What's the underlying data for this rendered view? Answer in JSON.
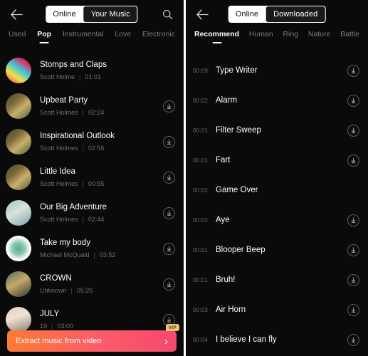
{
  "left_panel": {
    "back_icon": "back-arrow-icon",
    "search_icon": "search-icon",
    "segmented": {
      "online": "Online",
      "selected": "Your Music"
    },
    "categories": [
      "Used",
      "Pop",
      "Instrumental",
      "Love",
      "Electronic"
    ],
    "active_category": "Pop",
    "songs": [
      {
        "title": "Stomps and Claps",
        "artist": "Scott Holme",
        "duration": "01:01",
        "has_download": false,
        "art": "art-rainbow"
      },
      {
        "title": "Upbeat Party",
        "artist": "Scott Holmes",
        "duration": "02:24",
        "has_download": true,
        "art": "art-forest"
      },
      {
        "title": "Inspirational Outlook",
        "artist": "Scott Holmes",
        "duration": "02:56",
        "has_download": true,
        "art": "art-forest"
      },
      {
        "title": "Little Idea",
        "artist": "Scott Holmes",
        "duration": "00:55",
        "has_download": true,
        "art": "art-forest"
      },
      {
        "title": "Our Big Adventure",
        "artist": "Scott Holmes",
        "duration": "02:44",
        "has_download": true,
        "art": "art-map"
      },
      {
        "title": "Take my body",
        "artist": "Michael McQuaid",
        "duration": "03:52",
        "has_download": true,
        "art": "art-plate"
      },
      {
        "title": "CROWN",
        "artist": "Unknown",
        "duration": "05:26",
        "has_download": true,
        "art": "art-room"
      },
      {
        "title": "JULY",
        "artist": "19",
        "duration": "03:00",
        "has_download": true,
        "art": "art-tree"
      }
    ],
    "banner": {
      "text": "Extract music from video",
      "badge": "VIP",
      "chevron": "chevron-right-icon"
    }
  },
  "right_panel": {
    "back_icon": "back-arrow-icon",
    "segmented": {
      "online": "Online",
      "selected": "Downloaded"
    },
    "categories": [
      "Recommend",
      "Human",
      "Ring",
      "Nature",
      "Battle"
    ],
    "active_category": "Recommend",
    "sounds": [
      {
        "duration": "00:09",
        "name": "Type Writer",
        "has_download": true
      },
      {
        "duration": "00:02",
        "name": "Alarm",
        "has_download": true
      },
      {
        "duration": "00:01",
        "name": "Filter Sweep",
        "has_download": true
      },
      {
        "duration": "00:01",
        "name": "Fart",
        "has_download": true
      },
      {
        "duration": "00:02",
        "name": "Game Over",
        "has_download": false
      },
      {
        "duration": "00:02",
        "name": "Aye",
        "has_download": true
      },
      {
        "duration": "00:01",
        "name": "Blooper Beep",
        "has_download": true
      },
      {
        "duration": "00:01",
        "name": "Bruh!",
        "has_download": true
      },
      {
        "duration": "00:03",
        "name": "Air Horn",
        "has_download": true
      },
      {
        "duration": "00:04",
        "name": "I believe I can fly",
        "has_download": true
      }
    ]
  },
  "colors": {
    "background": "#0a0a0a",
    "text_primary": "#ffffff",
    "text_secondary": "#6e6e6e",
    "banner_start": "#fb7b34",
    "banner_end": "#f4496f",
    "vip_badge": "#f0c36d"
  }
}
